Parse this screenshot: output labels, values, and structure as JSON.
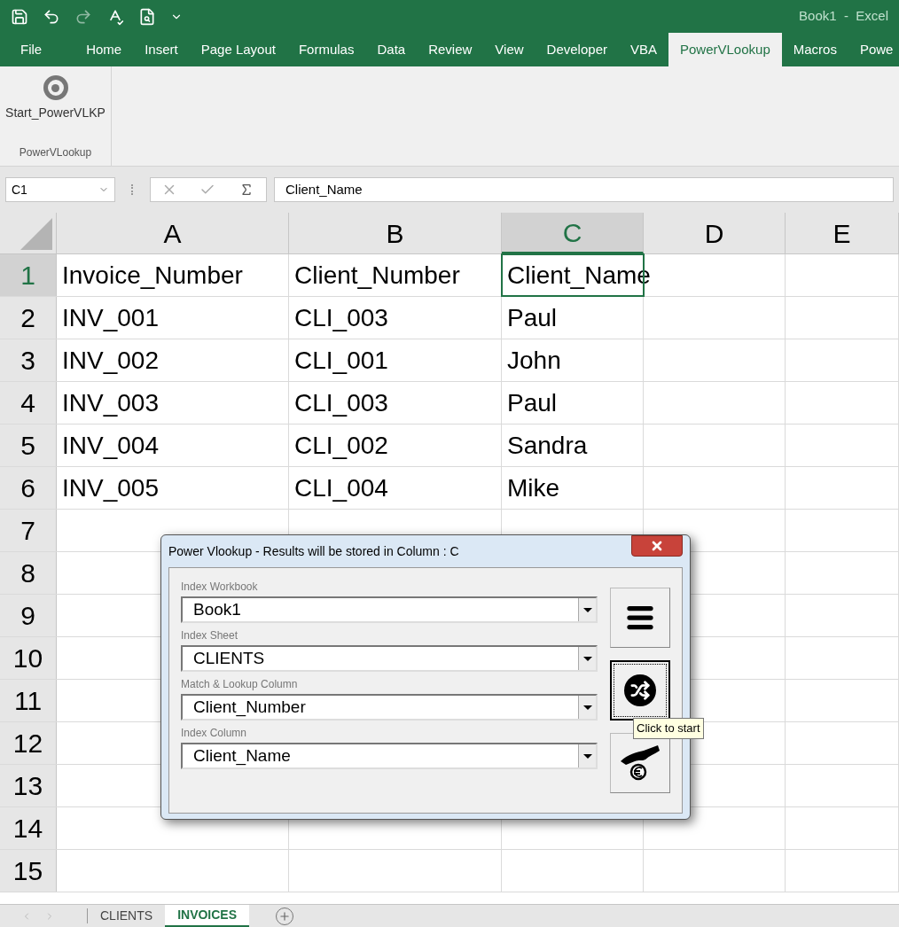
{
  "title_bar": {
    "title": "Book1  -  Excel"
  },
  "ribbon_tabs": [
    {
      "label": "File",
      "selected": false
    },
    {
      "label": "Home",
      "selected": false
    },
    {
      "label": "Insert",
      "selected": false
    },
    {
      "label": "Page Layout",
      "selected": false
    },
    {
      "label": "Formulas",
      "selected": false
    },
    {
      "label": "Data",
      "selected": false
    },
    {
      "label": "Review",
      "selected": false
    },
    {
      "label": "View",
      "selected": false
    },
    {
      "label": "Developer",
      "selected": false
    },
    {
      "label": "VBA",
      "selected": false
    },
    {
      "label": "PowerVLookup",
      "selected": true
    },
    {
      "label": "Macros",
      "selected": false
    },
    {
      "label": "Powe",
      "selected": false
    }
  ],
  "ribbon": {
    "button": "Start_PowerVLKP",
    "group": "PowerVLookup"
  },
  "formula_bar": {
    "name_box": "C1",
    "value": "Client_Name"
  },
  "sheet": {
    "columns": [
      {
        "label": "A",
        "selected": false
      },
      {
        "label": "B",
        "selected": false
      },
      {
        "label": "C",
        "selected": true
      },
      {
        "label": "D",
        "selected": false
      },
      {
        "label": "E",
        "selected": false
      }
    ],
    "rows": [
      {
        "number": "1",
        "selected": true,
        "cells": [
          "Invoice_Number",
          "Client_Number",
          "Client_Name"
        ]
      },
      {
        "number": "2",
        "selected": false,
        "cells": [
          "INV_001",
          "CLI_003",
          "Paul"
        ]
      },
      {
        "number": "3",
        "selected": false,
        "cells": [
          "INV_002",
          "CLI_001",
          "John"
        ]
      },
      {
        "number": "4",
        "selected": false,
        "cells": [
          "INV_003",
          "CLI_003",
          "Paul"
        ]
      },
      {
        "number": "5",
        "selected": false,
        "cells": [
          "INV_004",
          "CLI_002",
          "Sandra"
        ]
      },
      {
        "number": "6",
        "selected": false,
        "cells": [
          "INV_005",
          "CLI_004",
          "Mike"
        ]
      },
      {
        "number": "7",
        "selected": false,
        "cells": []
      },
      {
        "number": "8",
        "selected": false,
        "cells": []
      },
      {
        "number": "9",
        "selected": false,
        "cells": []
      },
      {
        "number": "10",
        "selected": false,
        "cells": []
      },
      {
        "number": "11",
        "selected": false,
        "cells": []
      },
      {
        "number": "12",
        "selected": false,
        "cells": []
      },
      {
        "number": "13",
        "selected": false,
        "cells": []
      },
      {
        "number": "14",
        "selected": false,
        "cells": []
      },
      {
        "number": "15",
        "selected": false,
        "cells": []
      }
    ]
  },
  "dialog": {
    "title": "Power Vlookup - Results will be stored in Column : C",
    "fields": [
      {
        "label": "Index Workbook",
        "value": "Book1"
      },
      {
        "label": "Index Sheet",
        "value": "CLIENTS"
      },
      {
        "label": "Match & Lookup Column",
        "value": "Client_Number"
      },
      {
        "label": "Index Column",
        "value": "Client_Name"
      }
    ],
    "buttons": [
      {
        "kind": "menu",
        "focused": false
      },
      {
        "kind": "shuffle",
        "focused": true
      },
      {
        "kind": "coin",
        "focused": false
      }
    ],
    "tooltip": "Click to start"
  },
  "sheet_tabs": [
    {
      "label": "CLIENTS",
      "selected": false
    },
    {
      "label": "INVOICES",
      "selected": true
    }
  ]
}
